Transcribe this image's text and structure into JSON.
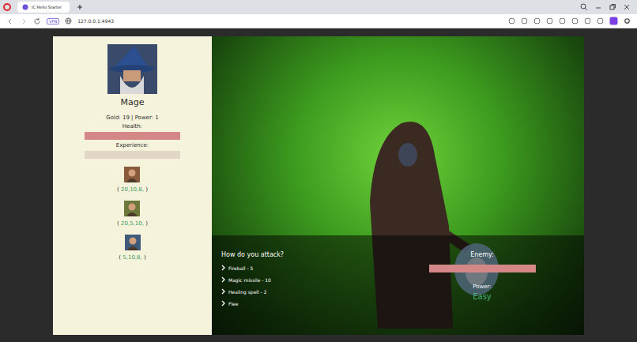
{
  "browser": {
    "tab_title": "IC Hello Starter",
    "address": "127.0.0.1:4943",
    "badge": "VPN"
  },
  "player": {
    "name": "Mage",
    "stats": "Gold: 19 | Power: 1",
    "health": {
      "label": "Health:",
      "level": 1
    },
    "experience": {
      "label": "Experience:",
      "level": 0
    }
  },
  "party": [
    {
      "open": "(",
      "stats": "20,10,8,",
      "close": ")"
    },
    {
      "open": "(",
      "stats": "20,5,10,",
      "close": ")"
    },
    {
      "open": "(",
      "stats": "5,10,8,",
      "close": ")"
    }
  ],
  "attack": {
    "prompt": "How do you attack?",
    "options": [
      "Fireball - 5",
      "Magic missile - 10",
      "Healing spell - 2",
      "Flee"
    ]
  },
  "enemy": {
    "label": "Enemy:",
    "health_level": 1,
    "power_label": "Power:",
    "power": "Easy"
  }
}
